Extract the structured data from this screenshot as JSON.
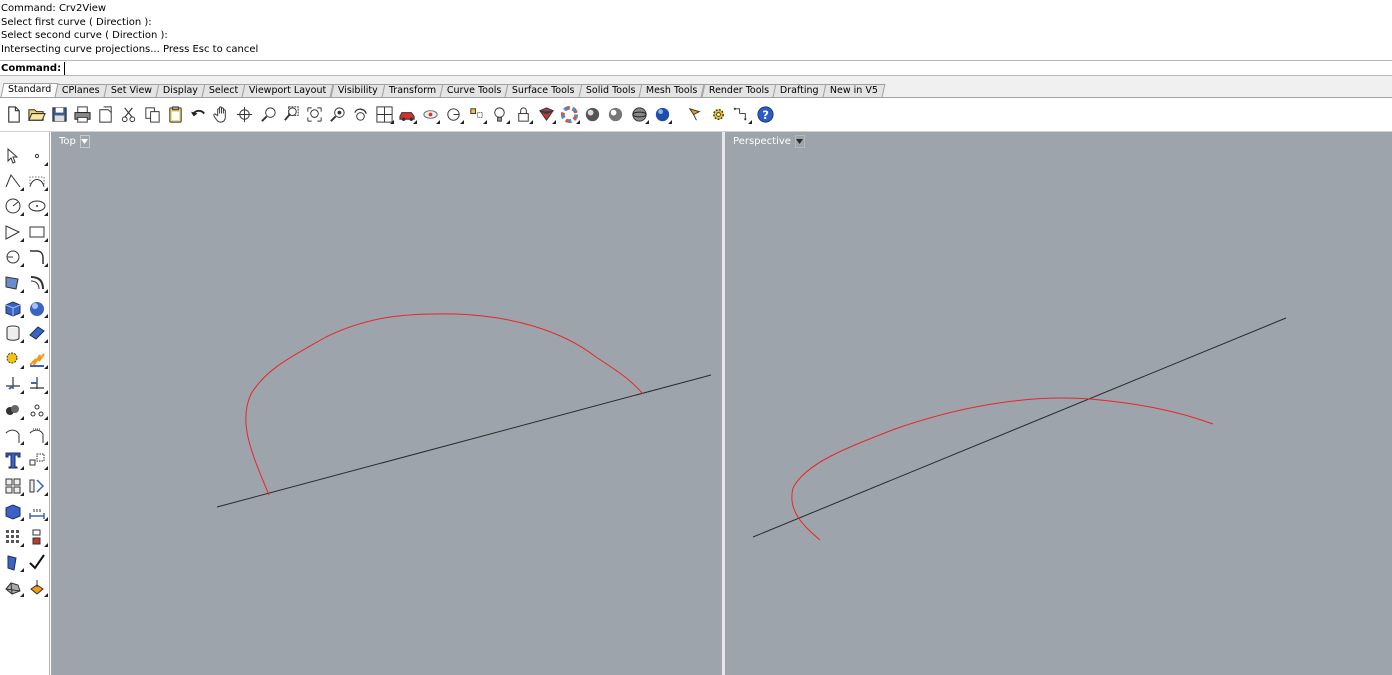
{
  "command_history": [
    "Command: Crv2View",
    "Select first curve ( Direction ):",
    "Select second curve ( Direction ):",
    "Intersecting curve projections... Press Esc to cancel"
  ],
  "command_prompt": {
    "label": "Command:",
    "value": ""
  },
  "tabs": [
    {
      "label": "Standard",
      "active": true
    },
    {
      "label": "CPlanes"
    },
    {
      "label": "Set View"
    },
    {
      "label": "Display"
    },
    {
      "label": "Select"
    },
    {
      "label": "Viewport Layout"
    },
    {
      "label": "Visibility"
    },
    {
      "label": "Transform"
    },
    {
      "label": "Curve Tools"
    },
    {
      "label": "Surface Tools"
    },
    {
      "label": "Solid Tools"
    },
    {
      "label": "Mesh Tools"
    },
    {
      "label": "Render Tools"
    },
    {
      "label": "Drafting"
    },
    {
      "label": "New in V5"
    }
  ],
  "toolbar_icons": [
    "new-file-icon",
    "open-folder-icon",
    "save-icon",
    "print-icon",
    "import-icon",
    "cut-icon",
    "copy-icon",
    "paste-icon",
    "undo-icon",
    "pan-hand-icon",
    "rotate-view-icon",
    "zoom-icon",
    "zoom-window-icon",
    "zoom-extents-icon",
    "zoom-selected-icon",
    "undo-view-icon",
    "four-viewports-icon",
    "car-icon",
    "car-eye-icon",
    "ghosted-view-icon",
    "lights-icon",
    "bulb-icon",
    "lock-icon",
    "shaded-icon",
    "color-wheel-icon",
    "rendered-sphere-icon",
    "sphere-icon",
    "material-sphere-icon",
    "blue-sphere-icon",
    "flag-icon",
    "gear-icon",
    "osnap-icon",
    "help-icon"
  ],
  "left_toolbar_icons": [
    [
      "select-arrow-icon",
      "point-icon"
    ],
    [
      "polyline-icon",
      "control-point-curve-icon"
    ],
    [
      "circle-icon",
      "ellipse-icon"
    ],
    [
      "polygon-icon",
      "rectangle-icon"
    ],
    [
      "arc-icon",
      "fillet-curve-icon"
    ],
    [
      "surface-points-icon",
      "sweep-icon"
    ],
    [
      "box-icon",
      "sphere-solid-icon"
    ],
    [
      "cylinder-icon",
      "surface-icon"
    ],
    [
      "gear-move-icon",
      "explode-icon"
    ],
    [
      "split-icon",
      "trim-icon"
    ],
    [
      "boolean-union-icon",
      "array-icon"
    ],
    [
      "offset-icon",
      "rebuild-icon"
    ],
    [
      "text-icon",
      "scale-icon"
    ],
    [
      "group-icon",
      "mirror-icon"
    ],
    [
      "extrude-icon",
      "dimension-icon"
    ],
    [
      "grid-array-icon",
      "block-icon"
    ],
    [
      "pipe-icon",
      "check-icon"
    ],
    [
      "mesh-icon",
      "analyze-icon"
    ]
  ],
  "viewports": {
    "left": {
      "name": "Top"
    },
    "right": {
      "name": "Perspective"
    }
  },
  "colors": {
    "viewport_bg": "#9ea4ab",
    "curve": "#e8262a",
    "line": "#2a2a2a"
  }
}
